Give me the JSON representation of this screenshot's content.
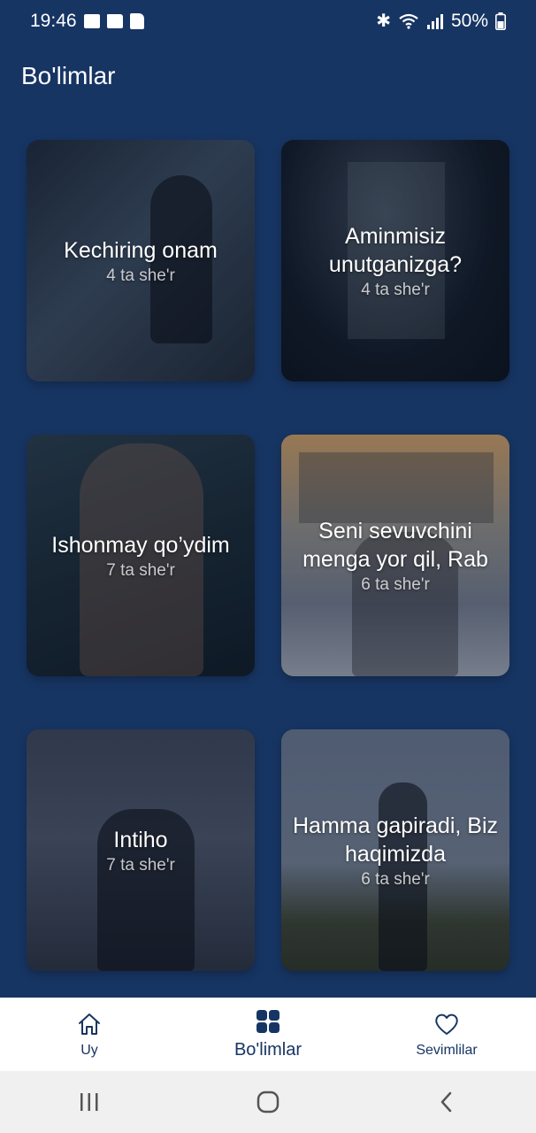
{
  "status_bar": {
    "time": "19:46",
    "battery": "50%",
    "left_icons": [
      "gallery-icon",
      "folder-icon",
      "sim-icon"
    ],
    "right_icons": [
      "bluetooth-icon",
      "wifi-icon",
      "signal-icon",
      "battery-icon"
    ]
  },
  "header": {
    "title": "Bo'limlar"
  },
  "cards": [
    {
      "title": "Kechiring onam",
      "count": "4 ta she'r"
    },
    {
      "title": "Aminmisiz unutganizga?",
      "count": "4 ta she'r"
    },
    {
      "title": "Ishonmay qo’ydim",
      "count": "7 ta she'r"
    },
    {
      "title": "Seni sevuvchini menga yor qil, Rab",
      "count": "6 ta she'r"
    },
    {
      "title": "Intiho",
      "count": "7 ta she'r"
    },
    {
      "title": "Hamma gapiradi, Biz haqimizda",
      "count": "6 ta she'r"
    }
  ],
  "bottom_nav": {
    "items": [
      {
        "label": "Uy",
        "icon": "home-icon",
        "active": false
      },
      {
        "label": "Bo'limlar",
        "icon": "grid-icon",
        "active": true
      },
      {
        "label": "Sevimlilar",
        "icon": "heart-icon",
        "active": false
      }
    ]
  },
  "colors": {
    "background": "#173563",
    "nav_background": "#ffffff",
    "accent": "#173563"
  }
}
